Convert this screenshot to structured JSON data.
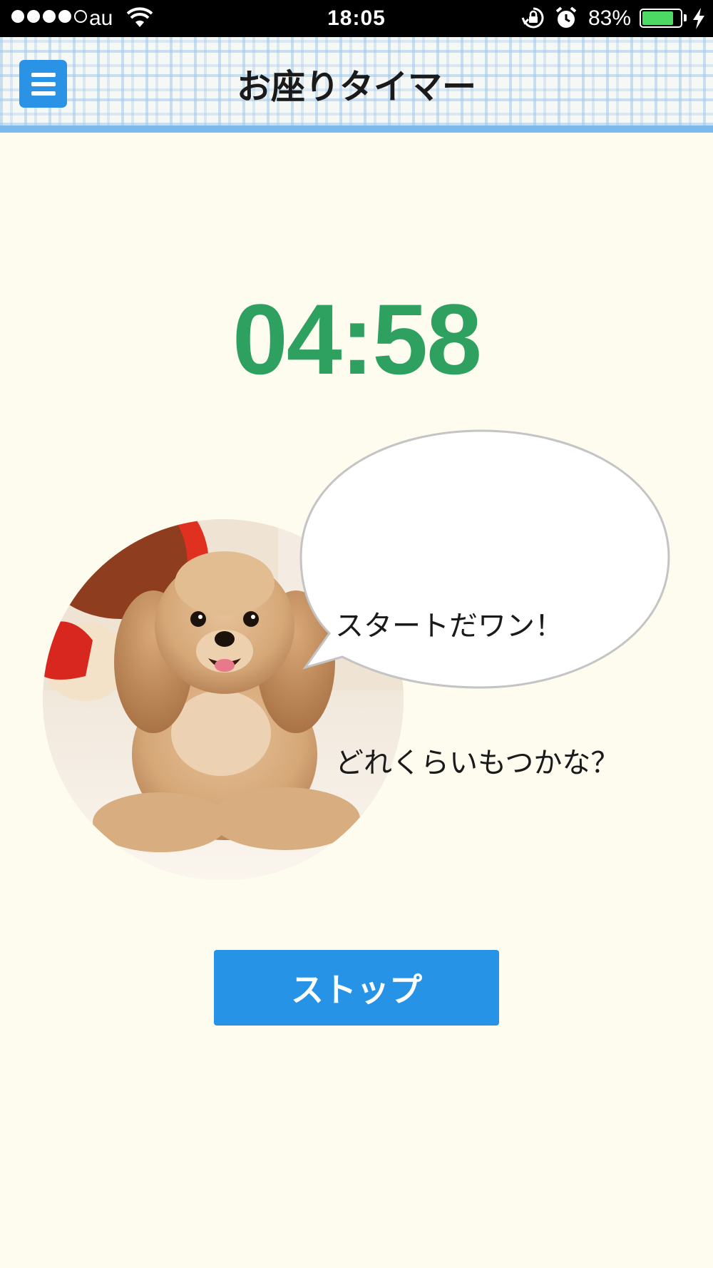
{
  "status_bar": {
    "carrier": "au",
    "time": "18:05",
    "battery_percent": "83%",
    "battery_level": 0.83,
    "signal_bars_filled": 4,
    "signal_bars_total": 5,
    "icons": [
      "signal-dots-icon",
      "wifi-icon",
      "rotation-lock-icon",
      "alarm-clock-icon",
      "battery-icon",
      "charging-bolt-icon"
    ]
  },
  "header": {
    "title": "お座りタイマー",
    "menu_icon": "hamburger-menu-icon"
  },
  "timer": {
    "display": "04:58",
    "color": "#2ea160"
  },
  "speech_bubble": {
    "lines": [
      "スタートだワン！",
      "どれくらいもつかな？"
    ]
  },
  "stop_button": {
    "label": "ストップ",
    "color": "#2693e6"
  },
  "colors": {
    "background": "#fefbef",
    "header_border": "#7cb9ec",
    "menu_button": "#2b93e6"
  }
}
